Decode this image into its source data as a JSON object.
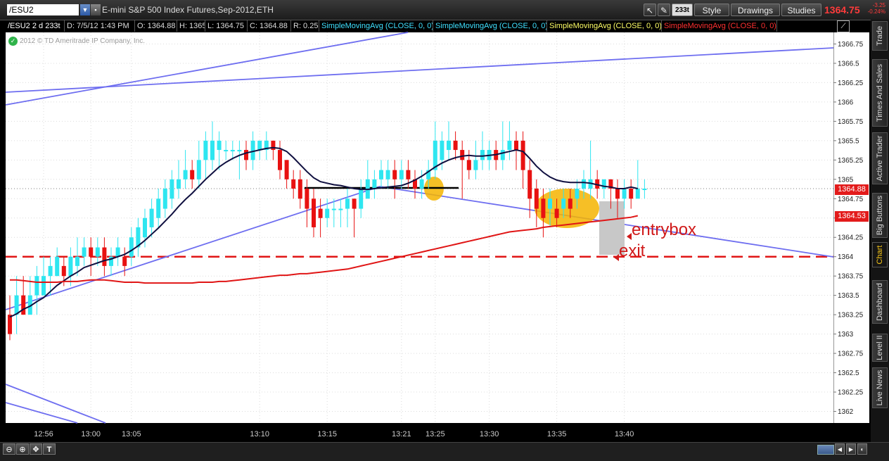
{
  "toolbar": {
    "symbol": "/ESU2",
    "description": "E-mini S&P 500 Index Futures,Sep-2012,ETH",
    "aggregation": "233t",
    "style_label": "Style",
    "drawings_label": "Drawings",
    "studies_label": "Studies",
    "last_price": "1364.75",
    "net_change": "-3.25",
    "pct_change": "-0.24%"
  },
  "infobar": {
    "period": "/ESU2 2 d 233t",
    "datetime": "D: 7/5/12 1:43 PM",
    "open": "O: 1364.88",
    "high": "H: 1365",
    "low": "L: 1364.75",
    "close": "C: 1364.88",
    "range": "R: 0.25",
    "studies": [
      {
        "label": "SimpleMovingAvg (CLOSE, 0, 0)",
        "color": "#3fe0ff"
      },
      {
        "label": "SimpleMovingAvg (CLOSE, 0, 0)",
        "color": "#3fe0ff"
      },
      {
        "label": "SimpleMovingAvg (CLOSE, 0, 0)",
        "color": "#ffff66"
      },
      {
        "label": "SimpleMovingAvg (CLOSE, 0, 0)",
        "color": "#ff3030"
      }
    ]
  },
  "copyright": "2012 © TD Ameritrade IP Company, Inc.",
  "annotations": {
    "entry": "entrybox",
    "exit": "exit"
  },
  "price_badges": {
    "current": "1364.88",
    "ma": "1364.53"
  },
  "side_tabs": [
    "Trade",
    "Times And Sales",
    "Active Trader",
    "Big Buttons",
    "Chart",
    "Dashboard",
    "Level II",
    "Live News"
  ],
  "bottom_buttons": [
    "zoom-out-icon",
    "zoom-in-icon",
    "crosshair-icon",
    "text-icon"
  ],
  "colors": {
    "up": "#2ee6f0",
    "down": "#e81111",
    "fast_ma": "#101040",
    "slow_ma": "#e01515",
    "trendline": "#6e6ef0",
    "highlight": "#f5b400",
    "box": "#c8c8c8"
  },
  "chart_data": {
    "type": "candlestick",
    "ylim": [
      1361.85,
      1366.9
    ],
    "y_ticks": [
      "1366.75",
      "1366.5",
      "1366.25",
      "1366",
      "1365.75",
      "1365.5",
      "1365.25",
      "1365",
      "1364.75",
      "1364.5",
      "1364.25",
      "1364",
      "1363.75",
      "1363.5",
      "1363.25",
      "1363",
      "1362.75",
      "1362.5",
      "1362.25",
      "1362"
    ],
    "x_ticks": [
      {
        "label": "12:56",
        "i": 5
      },
      {
        "label": "13:00",
        "i": 12
      },
      {
        "label": "13:05",
        "i": 18
      },
      {
        "label": "13:10",
        "i": 37
      },
      {
        "label": "13:15",
        "i": 47
      },
      {
        "label": "13:21",
        "i": 58
      },
      {
        "label": "13:25",
        "i": 63
      },
      {
        "label": "13:30",
        "i": 71
      },
      {
        "label": "13:35",
        "i": 81
      },
      {
        "label": "13:40",
        "i": 91
      }
    ],
    "candles": [
      [
        1363.25,
        1363.0,
        1363.5,
        1362.92
      ],
      [
        1363.25,
        1363.5,
        1363.75,
        1363.0
      ],
      [
        1363.5,
        1363.25,
        1363.75,
        1363.25
      ],
      [
        1363.25,
        1363.5,
        1363.75,
        1363.25
      ],
      [
        1363.5,
        1363.75,
        1363.88,
        1363.25
      ],
      [
        1363.5,
        1363.75,
        1364.0,
        1363.5
      ],
      [
        1363.75,
        1363.88,
        1364.0,
        1363.5
      ],
      [
        1363.75,
        1364.0,
        1364.12,
        1363.75
      ],
      [
        1363.88,
        1363.75,
        1364.0,
        1363.62
      ],
      [
        1363.75,
        1364.0,
        1364.12,
        1363.62
      ],
      [
        1363.88,
        1364.0,
        1364.25,
        1363.75
      ],
      [
        1364.0,
        1364.12,
        1364.25,
        1363.88
      ],
      [
        1364.12,
        1364.0,
        1364.25,
        1363.75
      ],
      [
        1364.0,
        1364.12,
        1364.25,
        1363.88
      ],
      [
        1364.12,
        1363.88,
        1364.25,
        1363.75
      ],
      [
        1363.88,
        1364.0,
        1364.12,
        1363.75
      ],
      [
        1364.0,
        1364.12,
        1364.25,
        1363.88
      ],
      [
        1364.0,
        1363.88,
        1364.12,
        1363.75
      ],
      [
        1364.0,
        1364.25,
        1364.38,
        1363.88
      ],
      [
        1364.12,
        1364.38,
        1364.5,
        1364.0
      ],
      [
        1364.25,
        1364.5,
        1364.62,
        1364.12
      ],
      [
        1364.38,
        1364.62,
        1364.75,
        1364.25
      ],
      [
        1364.5,
        1364.75,
        1364.88,
        1364.38
      ],
      [
        1364.62,
        1364.88,
        1365.0,
        1364.5
      ],
      [
        1364.75,
        1365.0,
        1365.12,
        1364.62
      ],
      [
        1364.88,
        1365.0,
        1365.25,
        1364.75
      ],
      [
        1365.0,
        1365.12,
        1365.38,
        1364.88
      ],
      [
        1365.12,
        1365.0,
        1365.25,
        1364.88
      ],
      [
        1365.0,
        1365.25,
        1365.5,
        1364.88
      ],
      [
        1365.25,
        1365.5,
        1365.62,
        1365.0
      ],
      [
        1365.25,
        1365.5,
        1365.75,
        1365.12
      ],
      [
        1365.38,
        1365.5,
        1365.62,
        1365.12
      ],
      [
        1365.38,
        1365.38,
        1365.5,
        1365.25
      ],
      [
        1365.38,
        1365.38,
        1365.5,
        1365.25
      ],
      [
        1365.38,
        1365.38,
        1365.5,
        1365.0
      ],
      [
        1365.38,
        1365.25,
        1365.5,
        1365.12
      ],
      [
        1365.25,
        1365.5,
        1365.62,
        1365.12
      ],
      [
        1365.38,
        1365.5,
        1365.5,
        1365.25
      ],
      [
        1365.38,
        1365.5,
        1365.62,
        1365.25
      ],
      [
        1365.5,
        1365.38,
        1365.5,
        1365.25
      ],
      [
        1365.38,
        1365.12,
        1365.5,
        1365.0
      ],
      [
        1365.25,
        1365.0,
        1365.25,
        1364.88
      ],
      [
        1365.0,
        1364.88,
        1365.12,
        1364.75
      ],
      [
        1365.0,
        1364.75,
        1365.12,
        1364.62
      ],
      [
        1364.88,
        1364.62,
        1365.0,
        1364.38
      ],
      [
        1364.75,
        1364.38,
        1364.88,
        1364.25
      ],
      [
        1364.62,
        1364.5,
        1364.75,
        1364.25
      ],
      [
        1364.5,
        1364.62,
        1364.75,
        1364.38
      ],
      [
        1364.62,
        1364.62,
        1364.75,
        1364.38
      ],
      [
        1364.62,
        1364.62,
        1364.75,
        1364.38
      ],
      [
        1364.62,
        1364.75,
        1364.88,
        1364.38
      ],
      [
        1364.75,
        1364.62,
        1364.75,
        1364.25
      ],
      [
        1364.62,
        1364.88,
        1365.0,
        1364.5
      ],
      [
        1364.75,
        1365.0,
        1365.25,
        1364.75
      ],
      [
        1364.88,
        1365.0,
        1365.12,
        1364.75
      ],
      [
        1365.0,
        1365.12,
        1365.25,
        1364.88
      ],
      [
        1365.0,
        1365.12,
        1365.25,
        1364.88
      ],
      [
        1365.12,
        1365.0,
        1365.25,
        1364.75
      ],
      [
        1365.0,
        1365.12,
        1365.25,
        1364.88
      ],
      [
        1365.12,
        1365.0,
        1365.25,
        1364.88
      ],
      [
        1365.0,
        1364.88,
        1365.12,
        1364.75
      ],
      [
        1364.88,
        1365.0,
        1365.12,
        1364.75
      ],
      [
        1365.0,
        1365.12,
        1365.25,
        1364.88
      ],
      [
        1365.12,
        1365.5,
        1365.75,
        1365.0
      ],
      [
        1365.25,
        1365.5,
        1365.62,
        1365.12
      ],
      [
        1365.38,
        1365.5,
        1365.75,
        1365.25
      ],
      [
        1365.5,
        1365.38,
        1365.62,
        1365.25
      ],
      [
        1365.38,
        1365.25,
        1365.5,
        1364.75
      ],
      [
        1365.25,
        1365.12,
        1365.38,
        1365.0
      ],
      [
        1365.12,
        1365.25,
        1365.5,
        1365.0
      ],
      [
        1365.25,
        1365.38,
        1365.62,
        1365.12
      ],
      [
        1365.25,
        1365.38,
        1365.5,
        1365.12
      ],
      [
        1365.38,
        1365.25,
        1365.5,
        1365.12
      ],
      [
        1365.25,
        1365.38,
        1365.75,
        1365.12
      ],
      [
        1365.38,
        1365.5,
        1365.75,
        1365.25
      ],
      [
        1365.5,
        1365.38,
        1365.62,
        1365.12
      ],
      [
        1365.5,
        1365.12,
        1365.62,
        1364.88
      ],
      [
        1365.12,
        1364.75,
        1365.25,
        1364.5
      ],
      [
        1364.88,
        1364.62,
        1365.0,
        1364.38
      ],
      [
        1364.75,
        1364.5,
        1364.88,
        1364.25
      ],
      [
        1364.62,
        1364.75,
        1364.88,
        1364.38
      ],
      [
        1364.62,
        1364.5,
        1364.75,
        1364.38
      ],
      [
        1364.62,
        1364.75,
        1364.88,
        1364.5
      ],
      [
        1364.75,
        1364.62,
        1364.88,
        1364.5
      ],
      [
        1364.75,
        1364.88,
        1365.0,
        1364.62
      ],
      [
        1364.88,
        1365.0,
        1365.12,
        1364.75
      ],
      [
        1364.88,
        1365.0,
        1365.5,
        1364.75
      ],
      [
        1365.0,
        1364.88,
        1365.12,
        1364.75
      ],
      [
        1364.88,
        1365.0,
        1365.0,
        1364.75
      ],
      [
        1365.0,
        1364.88,
        1365.0,
        1364.62
      ],
      [
        1364.88,
        1364.75,
        1365.0,
        1364.5
      ],
      [
        1364.75,
        1364.88,
        1365.0,
        1364.62
      ],
      [
        1364.88,
        1364.75,
        1365.0,
        1364.62
      ],
      [
        1364.75,
        1364.88,
        1365.25,
        1364.75
      ],
      [
        1364.88,
        1364.88,
        1365.0,
        1364.75
      ]
    ],
    "series": [
      {
        "values": [
          1363.22,
          1363.26,
          1363.32,
          1363.36,
          1363.42,
          1363.47,
          1363.55,
          1363.63,
          1363.69,
          1363.75,
          1363.8,
          1363.86,
          1363.89,
          1363.92,
          1363.95,
          1363.97,
          1364.0,
          1364.03,
          1364.08,
          1364.14,
          1364.21,
          1364.29,
          1364.37,
          1364.46,
          1364.55,
          1364.65,
          1364.74,
          1364.82,
          1364.91,
          1365.0,
          1365.08,
          1365.16,
          1365.22,
          1365.27,
          1365.31,
          1365.34,
          1365.36,
          1365.38,
          1365.4,
          1365.41,
          1365.4,
          1365.36,
          1365.28,
          1365.19,
          1365.1,
          1365.02,
          1364.97,
          1364.95,
          1364.93,
          1364.92,
          1364.9,
          1364.88,
          1364.87,
          1364.87,
          1364.88,
          1364.89,
          1364.9,
          1364.91,
          1364.92,
          1364.95,
          1364.99,
          1365.04,
          1365.1,
          1365.16,
          1365.21,
          1365.25,
          1365.28,
          1365.3,
          1365.31,
          1365.3,
          1365.3,
          1365.31,
          1365.32,
          1365.34,
          1365.36,
          1365.38,
          1365.36,
          1365.27,
          1365.17,
          1365.09,
          1365.03,
          1364.99,
          1364.97,
          1364.96,
          1364.96,
          1364.96,
          1364.95,
          1364.93,
          1364.91,
          1364.9,
          1364.88,
          1364.88,
          1364.9,
          1364.88
        ]
      },
      {
        "values": [
          1363.7,
          1363.7,
          1363.69,
          1363.68,
          1363.67,
          1363.67,
          1363.67,
          1363.67,
          1363.68,
          1363.68,
          1363.68,
          1363.69,
          1363.7,
          1363.7,
          1363.7,
          1363.69,
          1363.68,
          1363.67,
          1363.67,
          1363.67,
          1363.66,
          1363.66,
          1363.66,
          1363.66,
          1363.66,
          1363.66,
          1363.66,
          1363.66,
          1363.67,
          1363.67,
          1363.67,
          1363.68,
          1363.68,
          1363.69,
          1363.7,
          1363.71,
          1363.72,
          1363.73,
          1363.74,
          1363.75,
          1363.76,
          1363.76,
          1363.77,
          1363.78,
          1363.78,
          1363.79,
          1363.8,
          1363.81,
          1363.82,
          1363.83,
          1363.84,
          1363.86,
          1363.88,
          1363.9,
          1363.92,
          1363.94,
          1363.96,
          1363.98,
          1364.0,
          1364.02,
          1364.04,
          1364.06,
          1364.08,
          1364.1,
          1364.12,
          1364.14,
          1364.16,
          1364.18,
          1364.2,
          1364.22,
          1364.24,
          1364.26,
          1364.28,
          1364.3,
          1364.32,
          1364.33,
          1364.34,
          1364.35,
          1364.36,
          1364.38,
          1364.39,
          1364.4,
          1364.41,
          1364.42,
          1364.43,
          1364.44,
          1364.45,
          1364.46,
          1364.47,
          1364.48,
          1364.49,
          1364.5,
          1364.51,
          1364.53
        ]
      }
    ],
    "reference_lines": [
      1364.0,
      1364.88
    ]
  }
}
